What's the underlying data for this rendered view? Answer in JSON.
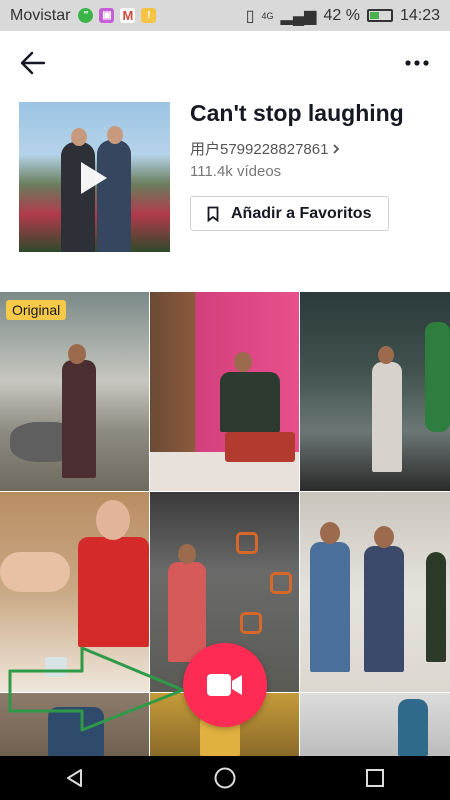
{
  "status_bar": {
    "carrier": "Movistar",
    "network": "4G",
    "battery": "42 %",
    "battery_level": 0.42,
    "time": "14:23"
  },
  "header": {
    "back_icon": "arrow-left-icon",
    "more_icon": "more-horizontal-icon"
  },
  "sound": {
    "title": "Can't stop laughing",
    "user": "用户5799228827861",
    "video_count": "111.4k vídeos",
    "favorite_label": "Añadir a Favoritos"
  },
  "grid": {
    "original_badge": "Original",
    "tiles": 9
  },
  "record_icon": "video-camera-icon",
  "colors": {
    "accent": "#fe2c55",
    "badge": "#f7c948",
    "annotation_arrow": "#2e9a48"
  }
}
